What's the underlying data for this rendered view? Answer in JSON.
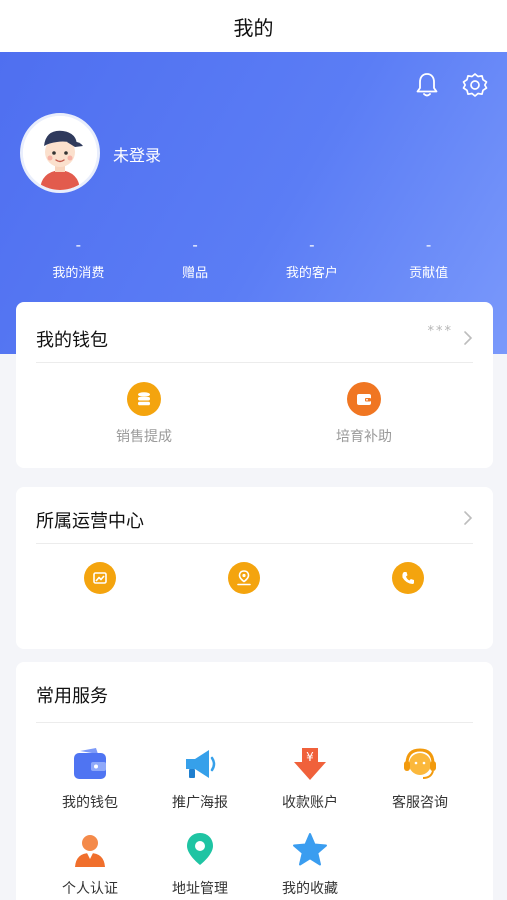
{
  "header": {
    "title": "我的"
  },
  "profile": {
    "login_status": "未登录"
  },
  "stats": [
    {
      "value": "-",
      "label": "我的消费"
    },
    {
      "value": "-",
      "label": "赠品"
    },
    {
      "value": "-",
      "label": "我的客户"
    },
    {
      "value": "-",
      "label": "贡献值"
    }
  ],
  "wallet_card": {
    "title": "我的钱包",
    "masked_amount": "***",
    "items": [
      {
        "label": "销售提成",
        "icon": "coins-icon",
        "color": "#f4a40e"
      },
      {
        "label": "培育补助",
        "icon": "wallet-icon",
        "color": "#f07622"
      }
    ]
  },
  "ops_card": {
    "title": "所属运营中心",
    "icons": [
      "picture-icon",
      "location-icon",
      "phone-icon"
    ],
    "icon_color": "#f4a40e"
  },
  "services_card": {
    "title": "常用服务",
    "items": [
      {
        "label": "我的钱包",
        "icon": "wallet-icon"
      },
      {
        "label": "推广海报",
        "icon": "megaphone-icon"
      },
      {
        "label": "收款账户",
        "icon": "yuan-arrow-icon"
      },
      {
        "label": "客服咨询",
        "icon": "headset-icon"
      },
      {
        "label": "个人认证",
        "icon": "person-icon"
      },
      {
        "label": "地址管理",
        "icon": "location-pin-icon"
      },
      {
        "label": "我的收藏",
        "icon": "star-icon"
      }
    ]
  },
  "colors": {
    "hero_start": "#4f6ff0",
    "hero_end": "#7a99fb",
    "accent_orange": "#f4a40e"
  }
}
